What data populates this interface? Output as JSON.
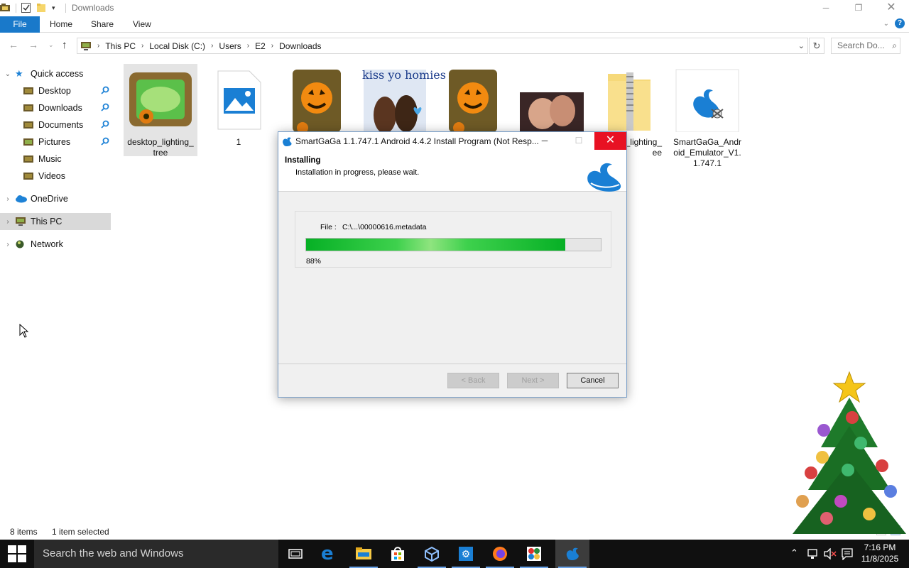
{
  "window": {
    "title": "Downloads"
  },
  "ribbon": {
    "file": "File",
    "tabs": [
      "Home",
      "Share",
      "View"
    ]
  },
  "address": {
    "crumbs": [
      "This PC",
      "Local Disk (C:)",
      "Users",
      "E2",
      "Downloads"
    ],
    "search_placeholder": "Search Do..."
  },
  "navpane": {
    "quick_access": "Quick access",
    "pinned": [
      "Desktop",
      "Downloads",
      "Documents",
      "Pictures"
    ],
    "unpinned": [
      "Music",
      "Videos"
    ],
    "onedrive": "OneDrive",
    "this_pc": "This PC",
    "network": "Network"
  },
  "files": {
    "item1": "desktop_lighting_\ntree",
    "item2": "1",
    "item4_caption": "kiss yo homies",
    "item7": "_lighting_\nee",
    "item8": "SmartGaGa_Andr\noid_Emulator_V1.\n1.747.1"
  },
  "status": {
    "count": "8 items",
    "selected": "1 item selected"
  },
  "dialog": {
    "title": "SmartGaGa 1.1.747.1 Android 4.4.2 Install Program (Not Resp...",
    "heading": "Installing",
    "subheading": "Installation in progress, please wait.",
    "file_label": "File :",
    "file_value": "C:\\...\\00000616.metadata",
    "progress_percent": 88,
    "progress_text": "88%",
    "back_label": "< Back",
    "next_label": "Next >",
    "cancel_label": "Cancel"
  },
  "taskbar": {
    "search_text": "Search the web and Windows",
    "time": "7:16 PM",
    "date": "11/8/2025"
  }
}
